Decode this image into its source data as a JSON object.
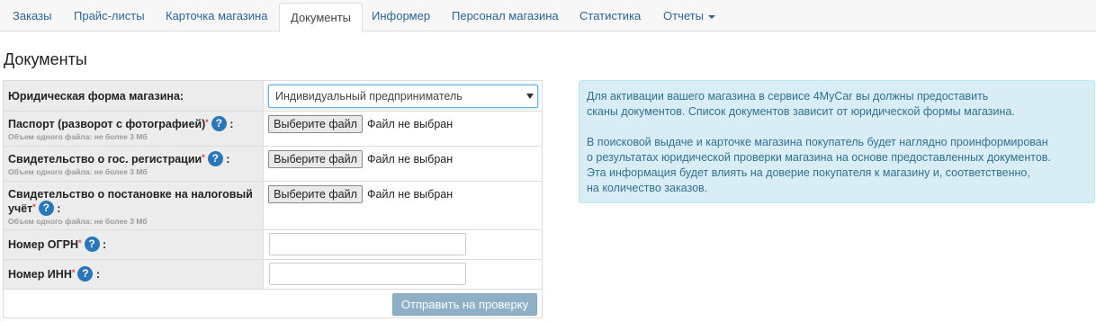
{
  "nav": {
    "tabs": [
      {
        "label": "Заказы"
      },
      {
        "label": "Прайс-листы"
      },
      {
        "label": "Карточка магазина"
      },
      {
        "label": "Документы",
        "active": true
      },
      {
        "label": "Информер"
      },
      {
        "label": "Персонал магазина"
      },
      {
        "label": "Статистика"
      },
      {
        "label": "Отчеты",
        "dropdown": true
      }
    ]
  },
  "page": {
    "title": "Документы"
  },
  "form": {
    "legal_form": {
      "label": "Юридическая форма магазина:",
      "value": "Индивидуальный предприниматель"
    },
    "passport": {
      "label": "Паспорт (разворот с фотографией)",
      "suffix": ":",
      "hint": "Объем одного файла: не более 3 Мб",
      "button": "Выберите файл",
      "status": "Файл не выбран"
    },
    "registration": {
      "label": "Свидетельство о гос. регистрации",
      "suffix": ":",
      "hint": "Объем одного файла: не более 3 Мб",
      "button": "Выберите файл",
      "status": "Файл не выбран"
    },
    "tax": {
      "label_line1": "Свидетельство о постановке на налоговый",
      "label_line2": "учёт",
      "suffix": ":",
      "hint": "Объем одного файла: не более 3 Мб",
      "button": "Выберите файл",
      "status": "Файл не выбран"
    },
    "ogrn": {
      "label": "Номер ОГРН",
      "suffix": ":",
      "value": ""
    },
    "inn": {
      "label": "Номер ИНН",
      "suffix": ":",
      "value": ""
    },
    "required_mark": "*",
    "help_glyph": "?",
    "submit_label": "Отправить на проверку"
  },
  "info": {
    "paragraph1": [
      "Для активации вашего магазина в сервисе 4MyCar вы должны предоставить",
      "сканы документов. Список документов зависит от юридической формы магазина."
    ],
    "paragraph2": [
      "В поисковой выдаче и карточке магазина покупатель будет наглядно проинформирован",
      "о результатах юридической проверки магазина на основе предоставленных документов.",
      "Эта информация будет влиять на доверие покупателя к магазину и, соответственно,",
      "на количество заказов."
    ]
  },
  "colors": {
    "link": "#2a6496",
    "help_icon": "#2a76bb",
    "required": "#e23b3b",
    "info_bg": "#d9edf7",
    "info_text": "#31708f",
    "submit_bg": "#8eb0c6"
  }
}
